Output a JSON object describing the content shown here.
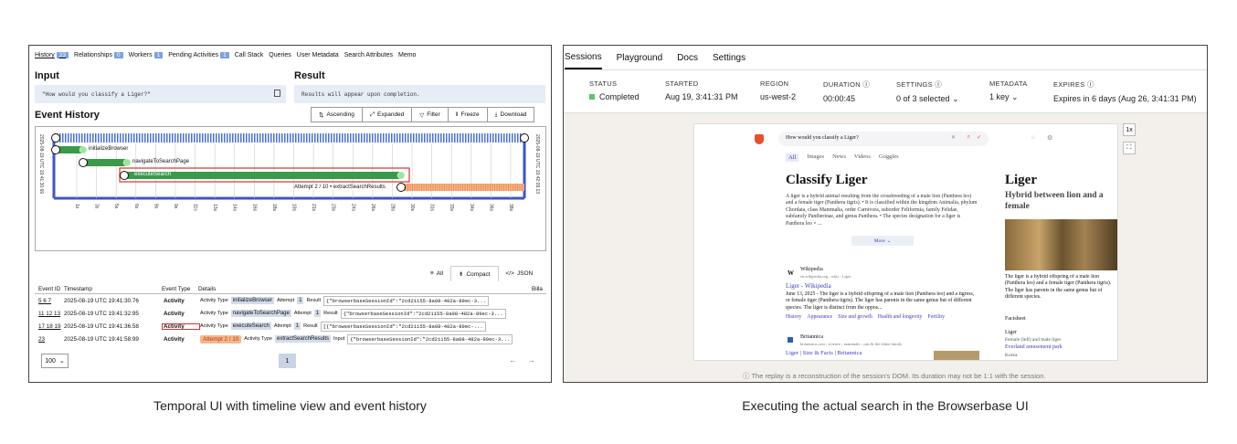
{
  "left": {
    "tabs": [
      {
        "label": "History",
        "count": "23"
      },
      {
        "label": "Relationships",
        "count": "0"
      },
      {
        "label": "Workers",
        "count": "1"
      },
      {
        "label": "Pending Activities",
        "count": "1"
      },
      {
        "label": "Call Stack",
        "count": ""
      },
      {
        "label": "Queries",
        "count": ""
      },
      {
        "label": "User Metadata",
        "count": ""
      },
      {
        "label": "Search Attributes",
        "count": ""
      },
      {
        "label": "Memo",
        "count": ""
      }
    ],
    "input_heading": "Input",
    "input_value": "\"How would you classify a Liger?\"",
    "result_heading": "Result",
    "result_value": "Results will appear upon completion.",
    "event_history_heading": "Event History",
    "buttons": [
      "Ascending",
      "Expanded",
      "Filter",
      "Freeze",
      "Download"
    ],
    "timeline": {
      "start_label": "2025-08-19 UTC 19:41:30.69",
      "end_label": "2025-08-19 UTC 19:42:09.13",
      "bars": [
        {
          "label": "initializeBrowser",
          "number": "1"
        },
        {
          "label": "navigateToSearchPage",
          "number": "2"
        },
        {
          "label": "executeSearch",
          "number": "3"
        },
        {
          "label": "Attempt 2 / 10 • extractSearchResults",
          "number": "4"
        }
      ],
      "ticks": [
        "1s",
        "3s",
        "5s",
        "6s",
        "8s",
        "9s",
        "11s",
        "13s",
        "14s",
        "16s",
        "18s",
        "19s",
        "21s",
        "23s",
        "24s",
        "26s",
        "28s",
        "30s",
        "31s",
        "33s",
        "34s",
        "36s",
        "38s"
      ]
    },
    "view_options": [
      "All",
      "Compact",
      "JSON"
    ],
    "table": {
      "headers": [
        "Event ID",
        "Timestamp",
        "Event Type",
        "Details",
        "Billa"
      ],
      "rows": [
        {
          "ids": "5 6 7",
          "timestamp": "2025-08-19 UTC 19:41:30.76",
          "type": "Activity",
          "attempt_badge": "",
          "activity_type": "initializeBrowser",
          "field1_label": "Attempt",
          "field1_value": "1",
          "field2_label": "Result",
          "field2_value": "{\"browserbaseSessionId\":\"2cd21155-8a08-482a-89ec-3..."
        },
        {
          "ids": "11 12 13",
          "timestamp": "2025-08-19 UTC 19:41:32.95",
          "type": "Activity",
          "attempt_badge": "",
          "activity_type": "navigateToSearchPage",
          "field1_label": "Attempt",
          "field1_value": "1",
          "field2_label": "Result",
          "field2_value": "{\"browserbaseSessionId\":\"2cd21155-8a08-482a-89ec-3..."
        },
        {
          "ids": "17 18 19",
          "timestamp": "2025-08-19 UTC 19:41:36.58",
          "type": "Activity",
          "attempt_badge": "",
          "activity_type": "executeSearch",
          "field1_label": "Attempt",
          "field1_value": "1",
          "field2_label": "Result",
          "field2_value": "[{\"browserbaseSessionId\":\"2cd21155-8a08-482a-89ec-..."
        },
        {
          "ids": "23",
          "timestamp": "2025-08-19 UTC 19:41:58.99",
          "type": "Activity",
          "attempt_badge": "Attempt 2 / 10",
          "activity_type": "extractSearchResults",
          "field1_label": "",
          "field1_value": "",
          "field2_label": "Input",
          "field2_value": "{\"browserbaseSessionId\":\"2cd21155-8a08-482a-89ec-3..."
        }
      ]
    },
    "page_size": "100",
    "page_number": "1"
  },
  "right": {
    "nav": [
      "Sessions",
      "Playground",
      "Docs",
      "Settings"
    ],
    "stats": [
      {
        "label": "Status",
        "value": "Completed"
      },
      {
        "label": "Started",
        "value": "Aug 19, 3:41:31 PM"
      },
      {
        "label": "Region",
        "value": "us-west-2"
      },
      {
        "label": "Duration",
        "value": "00:00:45"
      },
      {
        "label": "Settings",
        "value": "0 of 3 selected"
      },
      {
        "label": "Metadata",
        "value": "1 key"
      },
      {
        "label": "Expires",
        "value": "Expires in 6 days (Aug 26, 3:41:31 PM)"
      }
    ],
    "speed": "1x",
    "footnote": "The replay is a reconstruction of the session's DOM. Its duration may not be 1:1 with the session.",
    "browser": {
      "query": "How would you classify a Liger?",
      "tabs": [
        "All",
        "Images",
        "News",
        "Videos",
        "Goggles"
      ],
      "title": "Classify Liger",
      "summary": "A liger is a hybrid animal resulting from the crossbreeding of a male lion (Panthera leo) and a female tiger (Panthera tigris). • It is classified within the kingdom Animalia, phylum Chordata, class Mammalia, order Carnivora, suborder Feliformia, family Felidae, subfamily Pantherinae, and genus Panthera. • The species designation for a liger is Panthera leo × ...",
      "more": "More",
      "result1_site": "Wikipedia",
      "result1_url": "en.wikipedia.org › wiki › Liger",
      "result1_title": "Liger - Wikipedia",
      "result1_text": "June 13, 2025 - The liger is a hybrid offspring of a male lion (Panthera leo) and a tigress, or female tiger (Panthera tigris). The liger has parents in the same genus but of different species. The liger is distinct from the oppos...",
      "result1_links": [
        "History",
        "Appearance",
        "Size and growth",
        "Health and longevity",
        "Fertility"
      ],
      "result2_site": "Britannica",
      "result2_url": "britannica.com › science › mammals › cats & the feline family",
      "result2_title": "Liger | Size & Facts | Britannica",
      "side_title": "Liger",
      "side_subtitle": "Hybrid between lion and a female",
      "side_text": "The liger is a hybrid offspring of a male lion (Panthera leo) and a female tiger (Panthera tigris). The liger has parents in the same genus but of different species.",
      "factsheet": "Factsheet",
      "fact_name": "Liger",
      "fact_line": "Female (left) and male liger",
      "fact_link": "Everland amusement park",
      "fact_place": "Korea"
    }
  },
  "captions": {
    "left": "Temporal UI with timeline view and event history",
    "right": "Executing the actual search in the Browserbase UI"
  }
}
